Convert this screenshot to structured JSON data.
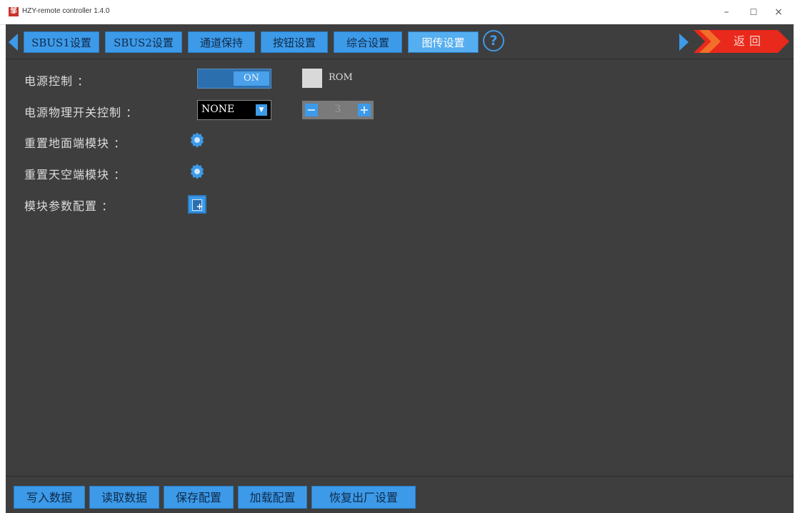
{
  "window": {
    "logo_text": "邹",
    "title": "HZY-remote controller 1.4.0",
    "minimize": "–",
    "maximize": "☐",
    "close": "×"
  },
  "tabs": [
    {
      "label": "SBUS1设置",
      "active": false
    },
    {
      "label": "SBUS2设置",
      "active": false
    },
    {
      "label": "通道保持",
      "active": false
    },
    {
      "label": "按钮设置",
      "active": false
    },
    {
      "label": "综合设置",
      "active": false
    },
    {
      "label": "图传设置",
      "active": true
    }
  ],
  "help_label": "?",
  "back_label": "返回",
  "settings": {
    "power_control": {
      "label": "电源控制 ：",
      "toggle_value": "ON",
      "rom_label": "ROM"
    },
    "power_switch_control": {
      "label": "电源物理开关控制 ：",
      "select_value": "NONE",
      "stepper_value": "3"
    },
    "reset_ground_module": {
      "label": "重置地面端模块 ："
    },
    "reset_air_module": {
      "label": "重置天空端模块 ："
    },
    "module_param_config": {
      "label": "模块参数配置 ："
    }
  },
  "bottom_buttons": [
    {
      "label": "写入数据"
    },
    {
      "label": "读取数据"
    },
    {
      "label": "保存配置"
    },
    {
      "label": "加载配置"
    },
    {
      "label": "恢复出厂设置"
    }
  ],
  "colors": {
    "accent": "#3d9ae8",
    "panel_bg": "#3e3e3e",
    "back_red": "#e8291c"
  }
}
